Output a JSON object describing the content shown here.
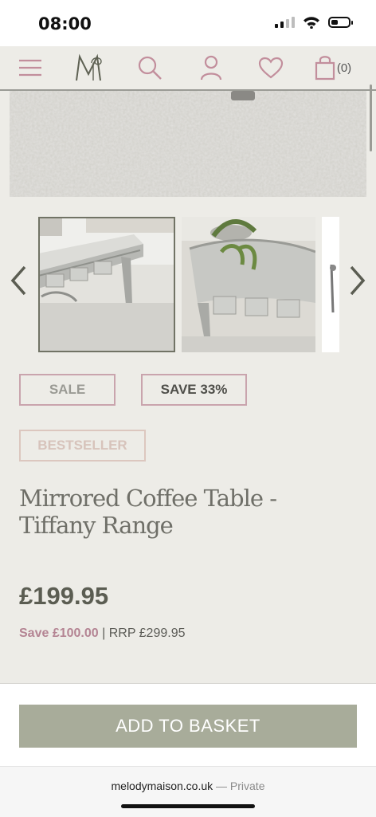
{
  "status": {
    "time": "08:00",
    "signal_bars": 2,
    "battery_level": 0.35
  },
  "nav": {
    "cart_count": "(0)",
    "icons": [
      "menu-icon",
      "brand-logo",
      "search-icon",
      "account-icon",
      "heart-icon",
      "basket-icon"
    ]
  },
  "badges": {
    "sale": "SALE",
    "save": "SAVE 33%",
    "bestseller": "BESTSELLER"
  },
  "product": {
    "title": "Mirrored Coffee Table - Tiffany Range",
    "price": "£199.95",
    "save": "Save £100.00",
    "rrp": "RRP £299.95"
  },
  "actions": {
    "add_to_basket": "ADD TO BASKET"
  },
  "browser": {
    "domain": "melodymaison.co.uk",
    "mode": "Private"
  },
  "colors": {
    "background": "#edece7",
    "accent_pink": "#c9a4ad",
    "price_olive": "#5b5d52",
    "button": "#a8ac9a"
  }
}
